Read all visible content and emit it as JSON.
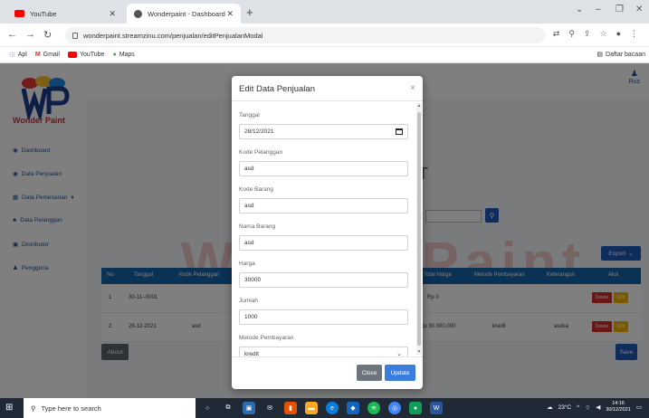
{
  "browser": {
    "tabs": [
      {
        "title": "YouTube",
        "favicon_color": "#ff0000",
        "active": false
      },
      {
        "title": "Wonderpaint - Dashboard",
        "favicon_color": "#555555",
        "active": true
      }
    ],
    "new_tab": "+",
    "url": "wonderpaint.streamzinu.com/penjualan/editPenjualanModal",
    "bookmarks": [
      {
        "label": "Apl",
        "icon": "apps-icon"
      },
      {
        "label": "Gmail",
        "icon": "gmail-icon"
      },
      {
        "label": "YouTube",
        "icon": "youtube-icon"
      },
      {
        "label": "Maps",
        "icon": "maps-icon"
      }
    ],
    "reading_list": "Daftar bacaan"
  },
  "sidebar": {
    "brand": "Wonder Paint",
    "items": [
      {
        "label": "Dashboard"
      },
      {
        "label": "Data Penjualan"
      },
      {
        "label": "Data Pemesanan"
      },
      {
        "label": "Data Pelanggan"
      },
      {
        "label": "Distributor"
      },
      {
        "label": "Pengguna"
      }
    ]
  },
  "header": {
    "user_label": "Rus"
  },
  "background": {
    "watermark": "WonderPaint",
    "export_label": "Export",
    "about_label": "About",
    "save_label": "Save",
    "table_headers": [
      "No",
      "Tanggal",
      "Kode Pelanggan",
      "Total Harga",
      "Metode Pembayaran",
      "Keterangan",
      "Aksi"
    ],
    "rows": [
      {
        "no": "1",
        "tanggal": "30-11--0001",
        "kode": "",
        "total": "Rp 0",
        "metode": "",
        "ket": ""
      },
      {
        "no": "2",
        "tanggal": "28-12-2021",
        "kode": "asd",
        "total": "Rp 30.000.000",
        "metode": "kredit",
        "ket": "asdsa"
      }
    ],
    "delete_label": "Delete",
    "edit_label": "Edit"
  },
  "modal": {
    "title": "Edit Data Penjualan",
    "close_x": "×",
    "fields": [
      {
        "label": "Tanggal",
        "value": "28/12/2021"
      },
      {
        "label": "Kode Pelanggan",
        "value": "asd"
      },
      {
        "label": "Kode Barang",
        "value": "asd"
      },
      {
        "label": "Nama Barang",
        "value": "asd"
      },
      {
        "label": "Harga",
        "value": "30000"
      },
      {
        "label": "Jumlah",
        "value": "1000"
      },
      {
        "label": "Metode Pembayaran",
        "value": "kredit"
      }
    ],
    "close_label": "Close",
    "update_label": "Update"
  },
  "taskbar": {
    "search_placeholder": "Type here to search",
    "temperature": "23°C",
    "time": "14:16",
    "date": "30/12/2021"
  }
}
